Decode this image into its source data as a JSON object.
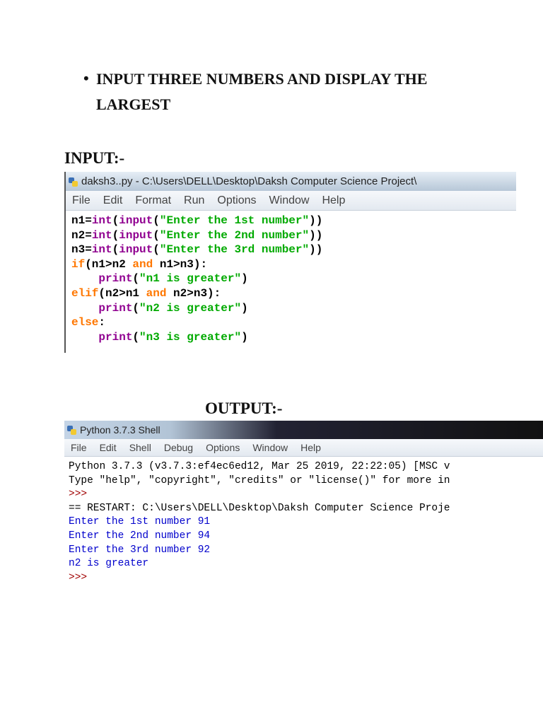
{
  "heading": {
    "bullet": "•",
    "text": "INPUT THREE NUMBERS AND DISPLAY THE LARGEST"
  },
  "input_label": "INPUT:-",
  "output_label": "OUTPUT:-",
  "editor": {
    "title": "daksh3..py - C:\\Users\\DELL\\Desktop\\Daksh Computer Science Project\\",
    "menu": [
      "File",
      "Edit",
      "Format",
      "Run",
      "Options",
      "Window",
      "Help"
    ],
    "colors": {
      "kw": "#ff7700",
      "builtin": "#900090",
      "str": "#00aa00",
      "plain": "#000000"
    },
    "lines": [
      [
        {
          "t": "n1=",
          "c": "plain"
        },
        {
          "t": "int",
          "c": "builtin"
        },
        {
          "t": "(",
          "c": "plain"
        },
        {
          "t": "input",
          "c": "builtin"
        },
        {
          "t": "(",
          "c": "plain"
        },
        {
          "t": "\"Enter the 1st number\"",
          "c": "str"
        },
        {
          "t": "))",
          "c": "plain"
        }
      ],
      [
        {
          "t": "n2=",
          "c": "plain"
        },
        {
          "t": "int",
          "c": "builtin"
        },
        {
          "t": "(",
          "c": "plain"
        },
        {
          "t": "input",
          "c": "builtin"
        },
        {
          "t": "(",
          "c": "plain"
        },
        {
          "t": "\"Enter the 2nd number\"",
          "c": "str"
        },
        {
          "t": "))",
          "c": "plain"
        }
      ],
      [
        {
          "t": "n3=",
          "c": "plain"
        },
        {
          "t": "int",
          "c": "builtin"
        },
        {
          "t": "(",
          "c": "plain"
        },
        {
          "t": "input",
          "c": "builtin"
        },
        {
          "t": "(",
          "c": "plain"
        },
        {
          "t": "\"Enter the 3rd number\"",
          "c": "str"
        },
        {
          "t": "))",
          "c": "plain"
        }
      ],
      [
        {
          "t": "if",
          "c": "kw"
        },
        {
          "t": "(n1>n2 ",
          "c": "plain"
        },
        {
          "t": "and",
          "c": "kw"
        },
        {
          "t": " n1>n3):",
          "c": "plain"
        }
      ],
      [
        {
          "t": "    ",
          "c": "plain"
        },
        {
          "t": "print",
          "c": "builtin"
        },
        {
          "t": "(",
          "c": "plain"
        },
        {
          "t": "\"n1 is greater\"",
          "c": "str"
        },
        {
          "t": ")",
          "c": "plain"
        }
      ],
      [
        {
          "t": "elif",
          "c": "kw"
        },
        {
          "t": "(n2>n1 ",
          "c": "plain"
        },
        {
          "t": "and",
          "c": "kw"
        },
        {
          "t": " n2>n3):",
          "c": "plain"
        }
      ],
      [
        {
          "t": "    ",
          "c": "plain"
        },
        {
          "t": "print",
          "c": "builtin"
        },
        {
          "t": "(",
          "c": "plain"
        },
        {
          "t": "\"n2 is greater\"",
          "c": "str"
        },
        {
          "t": ")",
          "c": "plain"
        }
      ],
      [
        {
          "t": "else",
          "c": "kw"
        },
        {
          "t": ":",
          "c": "plain"
        }
      ],
      [
        {
          "t": "    ",
          "c": "plain"
        },
        {
          "t": "print",
          "c": "builtin"
        },
        {
          "t": "(",
          "c": "plain"
        },
        {
          "t": "\"n3 is greater\"",
          "c": "str"
        },
        {
          "t": ")",
          "c": "plain"
        }
      ]
    ]
  },
  "shell": {
    "title": "Python 3.7.3 Shell",
    "menu": [
      "File",
      "Edit",
      "Shell",
      "Debug",
      "Options",
      "Window",
      "Help"
    ],
    "colors": {
      "plain": "#000000",
      "prompt": "#a00000",
      "stdout": "#0000cc"
    },
    "lines": [
      {
        "t": "Python 3.7.3 (v3.7.3:ef4ec6ed12, Mar 25 2019, 22:22:05) [MSC v",
        "c": "plain"
      },
      {
        "t": "Type \"help\", \"copyright\", \"credits\" or \"license()\" for more in",
        "c": "plain"
      },
      {
        "t": ">>>",
        "c": "prompt"
      },
      {
        "t": "== RESTART: C:\\Users\\DELL\\Desktop\\Daksh Computer Science Proje",
        "c": "plain"
      },
      {
        "t": "Enter the 1st number 91",
        "c": "stdout"
      },
      {
        "t": "Enter the 2nd number 94",
        "c": "stdout"
      },
      {
        "t": "Enter the 3rd number 92",
        "c": "stdout"
      },
      {
        "t": "n2 is greater",
        "c": "stdout"
      },
      {
        "t": ">>>",
        "c": "prompt"
      }
    ]
  }
}
